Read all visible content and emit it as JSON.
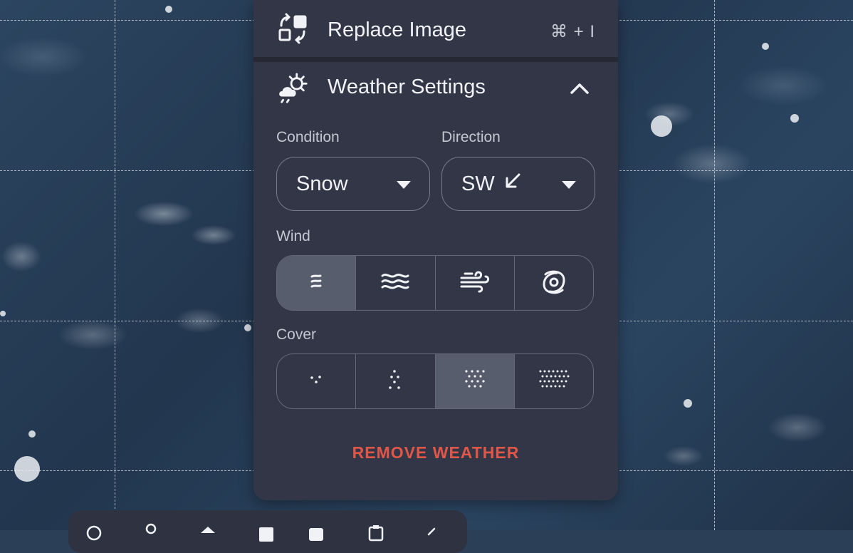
{
  "replace_row": {
    "title": "Replace Image",
    "shortcut": "⌘ + I",
    "icon": "replace-image-icon"
  },
  "weather_row": {
    "title": "Weather Settings",
    "icon": "weather-sun-cloud-icon",
    "expanded": true
  },
  "condition": {
    "label": "Condition",
    "value": "Snow"
  },
  "direction": {
    "label": "Direction",
    "value": "SW",
    "arrow": "↙"
  },
  "wind": {
    "label": "Wind",
    "options": [
      "wind-light-icon",
      "wind-moderate-icon",
      "wind-strong-icon",
      "hurricane-icon"
    ],
    "selected_index": 0
  },
  "cover": {
    "label": "Cover",
    "options": [
      "cover-sparse-icon",
      "cover-light-icon",
      "cover-medium-icon",
      "cover-dense-icon"
    ],
    "selected_index": 2
  },
  "remove_label": "REMOVE WEATHER",
  "colors": {
    "panel": "#333646",
    "danger": "#e0574a",
    "segment_active": "#585d6d"
  }
}
